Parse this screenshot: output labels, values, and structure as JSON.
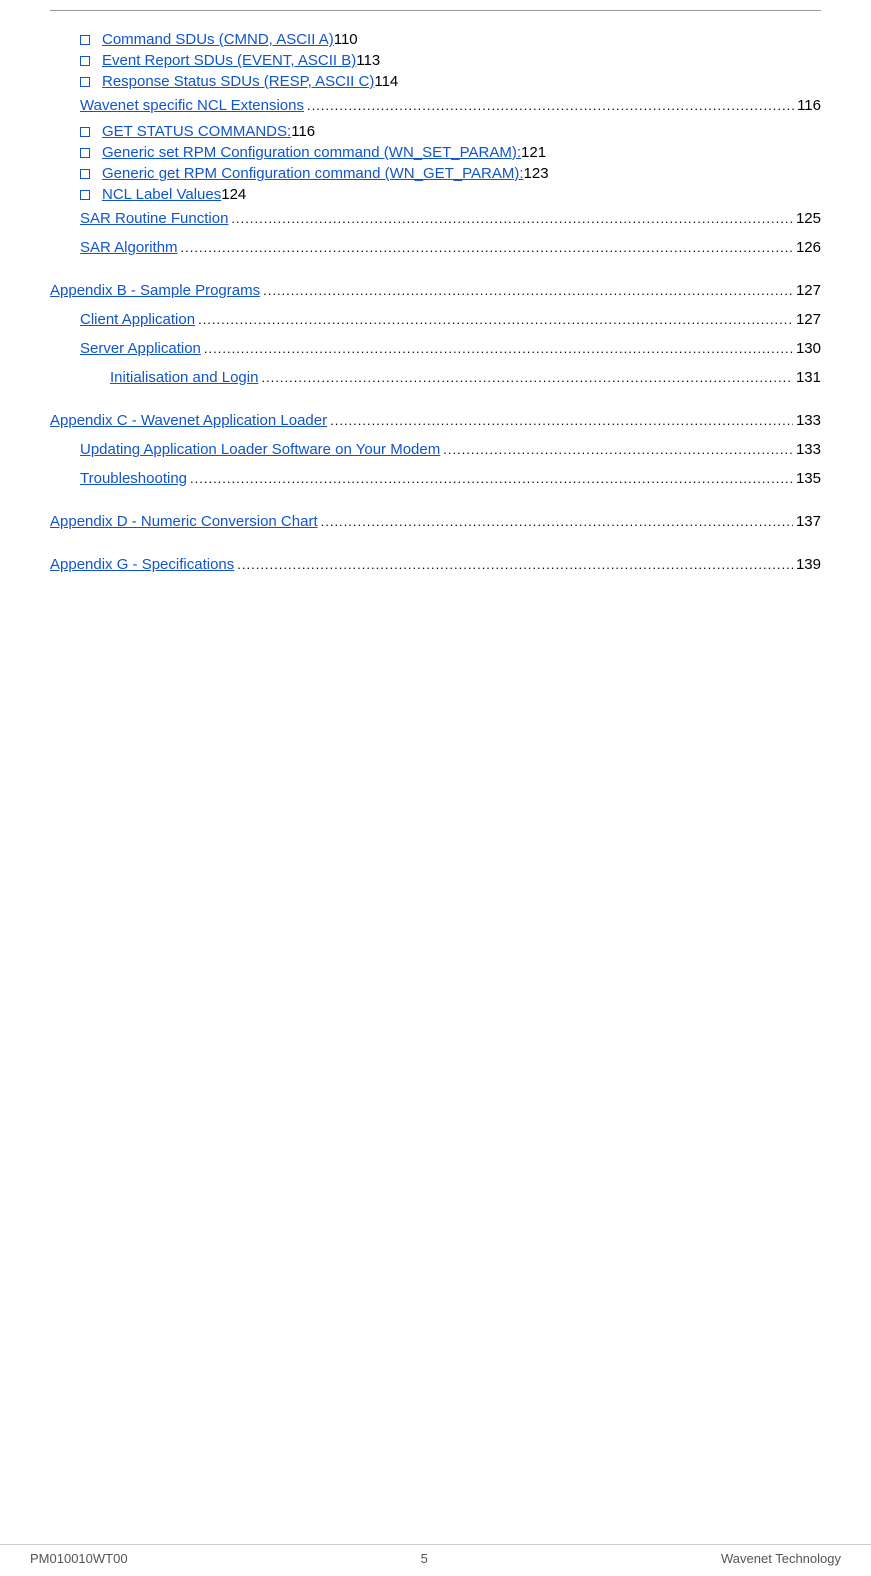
{
  "page": {
    "footer_left": "PM010010WT00",
    "footer_center": "5",
    "footer_right": "Wavenet Technology"
  },
  "toc": {
    "entries": [
      {
        "id": "cmd-sdus",
        "level": "bullet",
        "text": "Command SDUs (CMND, ASCII A)",
        "dots": true,
        "page": "110"
      },
      {
        "id": "event-sdus",
        "level": "bullet",
        "text": "Event Report SDUs (EVENT, ASCII B)",
        "dots": true,
        "page": "113"
      },
      {
        "id": "response-sdus",
        "level": "bullet",
        "text": "Response Status SDUs (RESP, ASCII C)",
        "dots": true,
        "page": "114"
      },
      {
        "id": "wavenet-ncl",
        "level": "2",
        "text": "Wavenet specific NCL Extensions",
        "dots": true,
        "page": "116"
      },
      {
        "id": "get-status",
        "level": "bullet",
        "text": "GET STATUS COMMANDS:",
        "dots": true,
        "page": "116"
      },
      {
        "id": "generic-set",
        "level": "bullet",
        "text": "Generic set RPM Configuration command (WN_SET_PARAM):",
        "dots": true,
        "page": "121"
      },
      {
        "id": "generic-get",
        "level": "bullet",
        "text": "Generic get RPM Configuration command (WN_GET_PARAM):",
        "dots": true,
        "page": "123"
      },
      {
        "id": "ncl-label",
        "level": "bullet",
        "text": "NCL Label Values",
        "dots": true,
        "page": "124"
      },
      {
        "id": "sar-routine",
        "level": "2",
        "text": "SAR Routine Function",
        "dots": true,
        "page": "125"
      },
      {
        "id": "sar-algorithm",
        "level": "2",
        "text": "SAR Algorithm",
        "dots": true,
        "page": "126"
      },
      {
        "id": "appendix-b",
        "level": "1",
        "text": "Appendix B - Sample Programs",
        "dots": true,
        "page": "127"
      },
      {
        "id": "client-app",
        "level": "2",
        "text": "Client Application",
        "dots": true,
        "page": "127"
      },
      {
        "id": "server-app",
        "level": "2",
        "text": "Server Application",
        "dots": true,
        "page": "130"
      },
      {
        "id": "init-login",
        "level": "3",
        "text": "Initialisation and Login",
        "dots": true,
        "page": "131"
      },
      {
        "id": "appendix-c",
        "level": "1",
        "text": "Appendix C - Wavenet Application Loader",
        "dots": true,
        "page": "133"
      },
      {
        "id": "updating-app",
        "level": "2",
        "text": "Updating Application Loader Software on Your Modem",
        "dots": true,
        "page": "133"
      },
      {
        "id": "troubleshooting",
        "level": "2",
        "text": "Troubleshooting",
        "dots": true,
        "page": "135"
      },
      {
        "id": "appendix-d",
        "level": "1",
        "text": "Appendix D - Numeric Conversion Chart",
        "dots": true,
        "page": "137"
      },
      {
        "id": "appendix-g",
        "level": "1",
        "text": "Appendix G - Specifications",
        "dots": true,
        "page": "139"
      }
    ]
  }
}
